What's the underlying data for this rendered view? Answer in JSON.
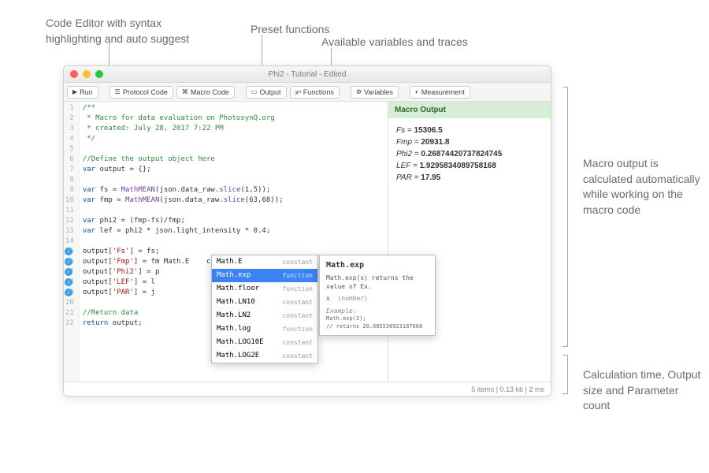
{
  "annotations": {
    "a1": "Code Editor with syntax\nhighlighting and auto suggest",
    "a2": "Preset functions",
    "a3": "Available variables and traces",
    "a4": "Macro output is calculated automatically while working on the macro code",
    "a5": "Calculation time, Output size and Parameter count"
  },
  "window": {
    "title": "Phi2 - Tutorial - Edited"
  },
  "toolbar": {
    "run": "Run",
    "protocol": "Protocol Code",
    "macro": "Macro Code",
    "output": "Output",
    "functions": "xⁿ Functions",
    "variables": "Variables",
    "measurement": "Measurement"
  },
  "code_lines": [
    {
      "n": 1,
      "cls": "c-com",
      "t": "/**"
    },
    {
      "n": 2,
      "cls": "c-com",
      "t": " * Macro for data evaluation on PhotosynQ.org"
    },
    {
      "n": 3,
      "cls": "c-com",
      "t": " * created: July 28, 2017 7:22 PM"
    },
    {
      "n": 4,
      "cls": "c-com",
      "t": " */"
    },
    {
      "n": 5,
      "cls": "",
      "t": ""
    },
    {
      "n": 6,
      "cls": "c-com",
      "t": "//Define the output object here"
    },
    {
      "n": 7,
      "cls": "",
      "t": "var output = {};"
    },
    {
      "n": 8,
      "cls": "",
      "t": ""
    },
    {
      "n": 9,
      "cls": "",
      "t": "var fs = MathMEAN(json.data_raw.slice(1,5));"
    },
    {
      "n": 10,
      "cls": "",
      "t": "var fmp = MathMEAN(json.data_raw.slice(63,68));"
    },
    {
      "n": 11,
      "cls": "",
      "t": ""
    },
    {
      "n": 12,
      "cls": "",
      "t": "var phi2 = (fmp-fs)/fmp;"
    },
    {
      "n": 13,
      "cls": "",
      "t": "var lef = phi2 * json.light_intensity * 0.4;"
    },
    {
      "n": 14,
      "cls": "",
      "t": ""
    },
    {
      "n": 15,
      "cls": "",
      "t": "output['Fs'] = fs;",
      "info": true
    },
    {
      "n": 16,
      "cls": "",
      "t": "output['Fmp'] = fm Math.E    constant",
      "info": true
    },
    {
      "n": 17,
      "cls": "",
      "t": "output['Phi2'] = p",
      "info": true
    },
    {
      "n": 18,
      "cls": "",
      "t": "output['LEF'] = l",
      "info": true
    },
    {
      "n": 19,
      "cls": "",
      "t": "output['PAR'] = j",
      "info": true
    },
    {
      "n": 20,
      "cls": "",
      "t": ""
    },
    {
      "n": 21,
      "cls": "c-com",
      "t": "//Return data"
    },
    {
      "n": 22,
      "cls": "",
      "t": "return output;"
    }
  ],
  "suggest": [
    {
      "name": "Math.E",
      "type": "constant"
    },
    {
      "name": "Math.exp",
      "type": "function",
      "sel": true
    },
    {
      "name": "Math.floor",
      "type": "function"
    },
    {
      "name": "Math.LN10",
      "type": "constant"
    },
    {
      "name": "Math.LN2",
      "type": "constant"
    },
    {
      "name": "Math.log",
      "type": "function"
    },
    {
      "name": "Math.LOG10E",
      "type": "constant"
    },
    {
      "name": "Math.LOG2E",
      "type": "constant"
    }
  ],
  "doc": {
    "title": "Math.exp",
    "desc": "Math.exp(x) returns the value of Ex.",
    "param_x": "x",
    "param_t": "(number)",
    "example_label": "Example:",
    "example_code": "Math.exp(3);\n// returns 20.085536923187668"
  },
  "output_panel": {
    "header": "Macro Output",
    "rows": [
      {
        "k": "Fs",
        "v": "15306.5"
      },
      {
        "k": "Fmp",
        "v": "20931.8"
      },
      {
        "k": "Phi2",
        "v": "0.26874420737824745"
      },
      {
        "k": "LEF",
        "v": "1.9295834089758168"
      },
      {
        "k": "PAR",
        "v": "17.95"
      }
    ]
  },
  "status": "5 items | 0.13 kb | 2 ms"
}
